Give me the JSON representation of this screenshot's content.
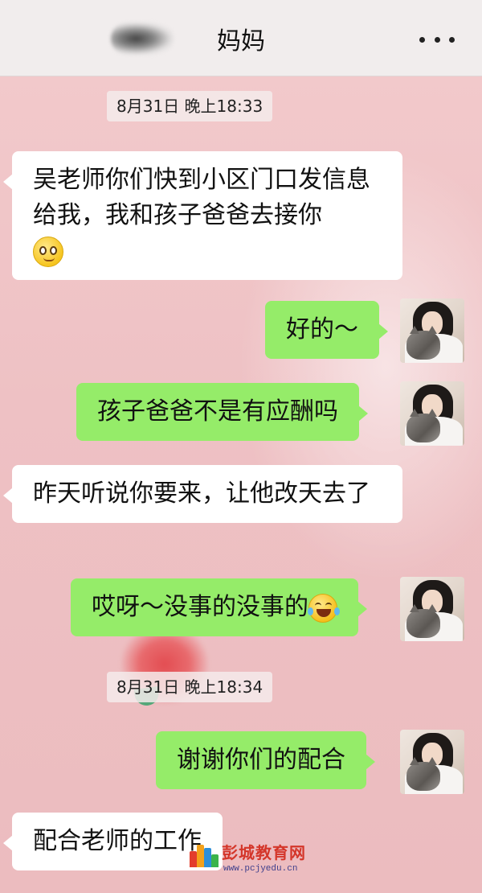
{
  "header": {
    "title": "妈妈",
    "more_icon": "more-dots-icon"
  },
  "timestamps": [
    "8月31日 晚上18:33",
    "8月31日 晚上18:34"
  ],
  "messages": [
    {
      "side": "left",
      "text": "吴老师你们快到小区门口发信息给我，我和孩子爸爸去接你",
      "emoji": "smile-emoji"
    },
    {
      "side": "right",
      "text": "好的～"
    },
    {
      "side": "right",
      "text": "孩子爸爸不是有应酬吗"
    },
    {
      "side": "left",
      "text": "昨天听说你要来，让他改天去了"
    },
    {
      "side": "right",
      "text": "哎呀～没事的没事的",
      "emoji": "laugh-cry-emoji"
    },
    {
      "side": "right",
      "text": "谢谢你们的配合"
    },
    {
      "side": "left",
      "text": "配合老师的工作"
    }
  ],
  "watermark": {
    "name": "彭城教育网",
    "url": "www.pcjyedu.cn"
  },
  "colors": {
    "sent_bubble": "#95ec69",
    "received_bubble": "#ffffff",
    "chat_background": "#efc6c9",
    "header_background": "#f1eded"
  }
}
